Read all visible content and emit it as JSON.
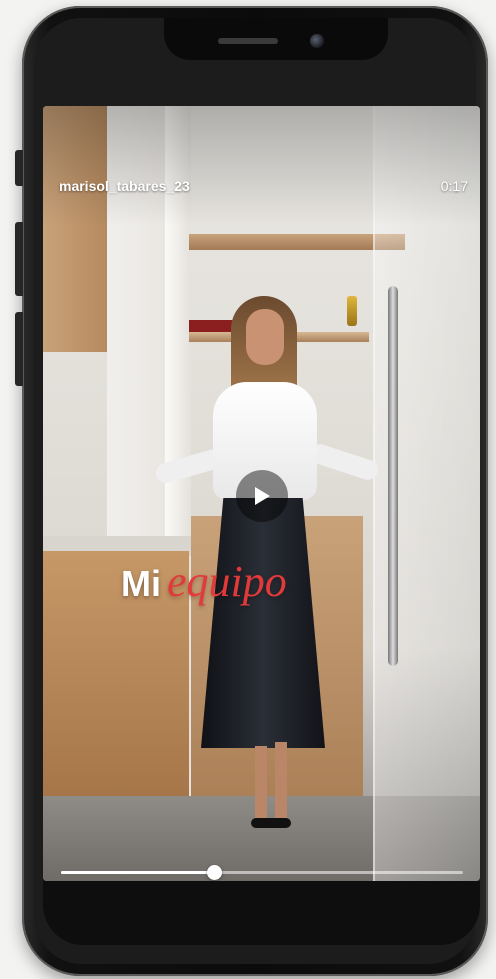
{
  "video": {
    "username": "marisol_tabares_23",
    "duration": "0:17",
    "caption_part1": "Mi",
    "caption_part2": "equipo",
    "progress_fraction": 0.38
  },
  "icons": {
    "play": "play-icon"
  }
}
